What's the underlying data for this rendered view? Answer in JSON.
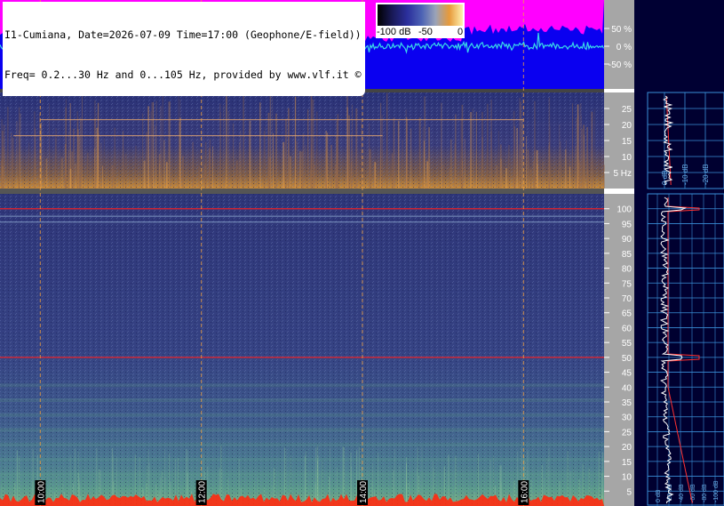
{
  "header": {
    "line1": "I1-Cumiana, Date=2026-07-09 Time=17:00 (Geophone/E-field))",
    "line2": "Freq= 0.2...30 Hz and 0...105 Hz, provided by www.vlf.it ©"
  },
  "colorbar": {
    "labels": [
      "-100 dB",
      "-50",
      "0"
    ]
  },
  "colors": {
    "waveform_bg": "#0a00f0",
    "waveform_trace": "#38d9e8",
    "waveform_burst": "#ff00ff",
    "spectrogram_low": "#283278",
    "spectrogram_high": "#f0a040",
    "grid": "#f0a040",
    "axis_bg": "#a6a6a6",
    "side_bg": "#000033",
    "side_grid": "#3a8fd8",
    "red_line": "#ff2020"
  },
  "chart_data": [
    {
      "type": "line",
      "panel": "waveform",
      "y_tick_labels": [
        "50 %",
        "0 %",
        "-50 %"
      ],
      "y_ticks": [
        50,
        0,
        -50
      ],
      "ylim": [
        -100,
        100
      ]
    },
    {
      "type": "heatmap",
      "panel": "spectrogram-0.2-30Hz",
      "y_tick_labels": [
        "25",
        "20",
        "15",
        "10",
        "5 Hz"
      ],
      "y_ticks": [
        25,
        20,
        15,
        10,
        5
      ],
      "ylim": [
        0,
        30
      ],
      "highlights": [
        {
          "name": "line",
          "y": 21.5,
          "x_range": [
            "10:00",
            "16:00"
          ]
        },
        {
          "name": "line",
          "y": 16.5,
          "x_range": [
            "09:40",
            "14:15"
          ]
        }
      ]
    },
    {
      "type": "heatmap",
      "panel": "spectrogram-0-105Hz",
      "y_tick_labels": [
        "100",
        "95",
        "90",
        "85",
        "80",
        "75",
        "70",
        "65",
        "60",
        "55",
        "50",
        "45",
        "40",
        "35",
        "30",
        "25",
        "20",
        "15",
        "10",
        "5"
      ],
      "y_ticks": [
        100,
        95,
        90,
        85,
        80,
        75,
        70,
        65,
        60,
        55,
        50,
        45,
        40,
        35,
        30,
        25,
        20,
        15,
        10,
        5
      ],
      "ylim": [
        0,
        105
      ],
      "x_tick_labels": [
        "10:00",
        "12:00",
        "14:00",
        "16:00"
      ],
      "x_ticks": [
        10,
        12,
        14,
        16
      ],
      "xlim": [
        9.5,
        17.0
      ],
      "lines": [
        {
          "name": "mains",
          "y": 50
        },
        {
          "name": "harmonic",
          "y": 100
        },
        {
          "name": "tone",
          "y": 97.5
        },
        {
          "name": "tone",
          "y": 95.5
        }
      ]
    },
    {
      "type": "line",
      "panel": "side-spectrum-upper",
      "x_tick_labels": [
        "0 dB",
        "-10 dB",
        "-20 dB"
      ],
      "y_ticks": [
        25,
        20,
        15,
        10,
        5
      ]
    },
    {
      "type": "line",
      "panel": "side-spectrum-lower",
      "x_tick_labels": [
        "0 dB",
        "-20 dB",
        "-40 dB",
        "-60 dB",
        "-80 dB",
        "-100 dB"
      ],
      "peaks": [
        {
          "y": 50
        },
        {
          "y": 100
        }
      ]
    }
  ]
}
